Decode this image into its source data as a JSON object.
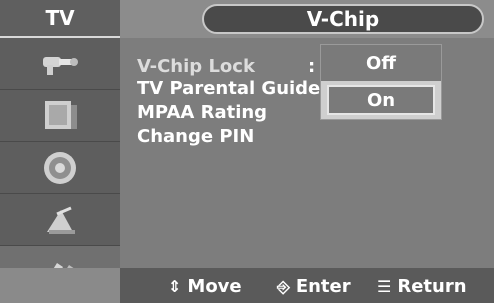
{
  "header": {
    "section": "TV",
    "title": "V-Chip"
  },
  "sidebar": {
    "icons": [
      "input-icon",
      "picture-icon",
      "sound-icon",
      "channel-icon",
      "setup-icon"
    ],
    "selected_index": 4
  },
  "menu": {
    "items": [
      {
        "label": "V-Chip Lock",
        "state": "active"
      },
      {
        "label": "TV Parental Guideli",
        "state": "normal"
      },
      {
        "label": "MPAA Rating",
        "state": "normal"
      },
      {
        "label": "Change PIN",
        "state": "normal"
      }
    ],
    "colon": ":"
  },
  "dropdown": {
    "options": [
      "Off",
      "On"
    ],
    "selected": "On"
  },
  "bottom_bar": {
    "move": "Move",
    "enter": "Enter",
    "return": "Return"
  }
}
